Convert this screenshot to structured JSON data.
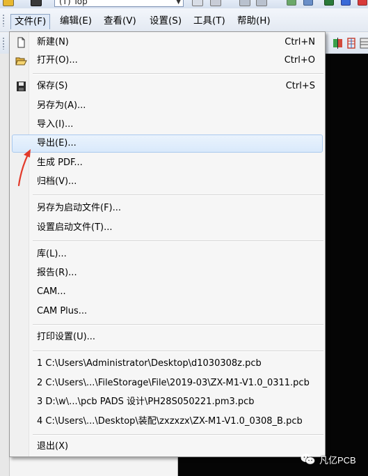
{
  "toolbar": {
    "layer_combo": "(T) Top"
  },
  "menubar": {
    "items": [
      {
        "label": "文件(F)"
      },
      {
        "label": "编辑(E)"
      },
      {
        "label": "查看(V)"
      },
      {
        "label": "设置(S)"
      },
      {
        "label": "工具(T)"
      },
      {
        "label": "帮助(H)"
      }
    ]
  },
  "file_menu": {
    "items": [
      {
        "label": "新建(N)",
        "shortcut": "Ctrl+N",
        "icon": "new-document-icon"
      },
      {
        "label": "打开(O)...",
        "shortcut": "Ctrl+O",
        "icon": "open-folder-icon"
      },
      {
        "label": "保存(S)",
        "shortcut": "Ctrl+S",
        "icon": "save-disk-icon"
      },
      {
        "label": "另存为(A)..."
      },
      {
        "label": "导入(I)..."
      },
      {
        "label": "导出(E)...",
        "highlighted": true
      },
      {
        "label": "生成 PDF..."
      },
      {
        "label": "归档(V)..."
      },
      {
        "label": "另存为启动文件(F)..."
      },
      {
        "label": "设置启动文件(T)..."
      },
      {
        "label": "库(L)..."
      },
      {
        "label": "报告(R)..."
      },
      {
        "label": "CAM..."
      },
      {
        "label": "CAM Plus..."
      },
      {
        "label": "打印设置(U)..."
      },
      {
        "label": "1 C:\\Users\\Administrator\\Desktop\\d1030308z.pcb"
      },
      {
        "label": "2 C:\\Users\\...\\FileStorage\\File\\2019-03\\ZX-M1-V1.0_0311.pcb"
      },
      {
        "label": "3 D:\\w\\...\\pcb  PADS 设计\\PH28S050221.pm3.pcb"
      },
      {
        "label": "4 C:\\Users\\...\\Desktop\\装配\\zxzxzx\\ZX-M1-V1.0_0308_B.pcb"
      },
      {
        "label": "退出(X)"
      }
    ]
  },
  "watermark": {
    "text": "凡亿PCB"
  },
  "colors": {
    "highlight": "#d9e9fb",
    "annotation_arrow": "#e23a2a",
    "canvas": "#050505"
  }
}
